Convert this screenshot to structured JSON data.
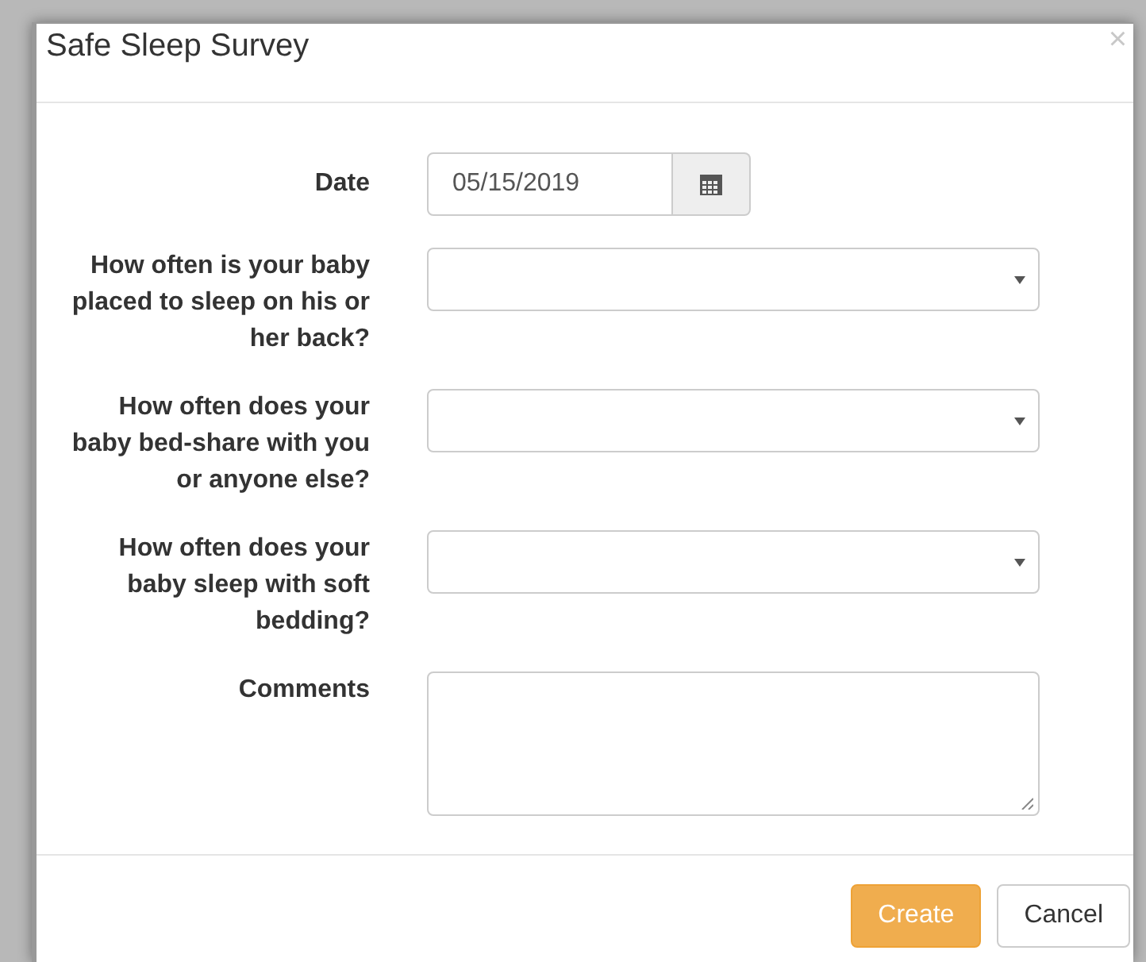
{
  "dialog": {
    "title": "Safe Sleep Survey",
    "close": "×"
  },
  "fields": [
    {
      "kind": "date",
      "label": "Date",
      "value": "05/15/2019"
    },
    {
      "kind": "select",
      "label": "How often is your baby placed to sleep on his or her back?"
    },
    {
      "kind": "select",
      "label": "How often does your baby bed-share with you or anyone else?"
    },
    {
      "kind": "select",
      "label": "How often does your baby sleep with soft bedding?"
    },
    {
      "kind": "textarea",
      "label": "Comments"
    }
  ],
  "buttons": [
    {
      "kind": "primary",
      "label": "Create"
    },
    {
      "kind": "default",
      "label": "Cancel"
    }
  ]
}
